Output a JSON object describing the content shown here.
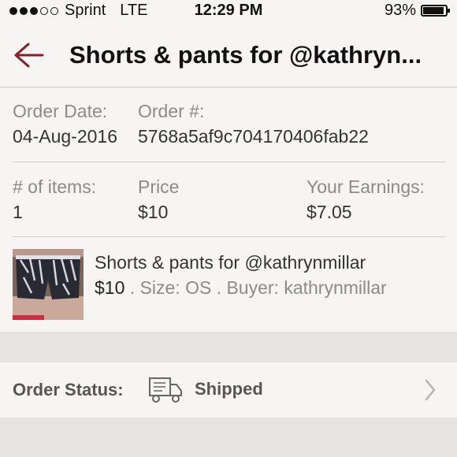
{
  "status_bar": {
    "carrier": "Sprint",
    "network": "LTE",
    "time": "12:29 PM",
    "battery": "93%",
    "battery_level": 0.93,
    "signal_bars_filled": 3,
    "signal_bars_total": 5
  },
  "header": {
    "back_icon": "back-arrow-icon",
    "title": "Shorts & pants for @kathryn...",
    "accent_color": "#8b1e2c"
  },
  "order": {
    "date_label": "Order Date:",
    "date_value": "04-Aug-2016",
    "number_label": "Order #:",
    "number_value": "5768a5af9c704170406fab22",
    "items_label": "# of items:",
    "items_value": "1",
    "price_label": "Price",
    "price_value": "$10",
    "earnings_label": "Your Earnings:",
    "earnings_value": "$7.05"
  },
  "item": {
    "title": "Shorts & pants for @kathrynmillar",
    "price": "$10",
    "details": " . Size: OS . Buyer: kathrynmillar"
  },
  "order_status": {
    "label": "Order Status:",
    "icon": "delivery-truck-icon",
    "value": "Shipped"
  }
}
